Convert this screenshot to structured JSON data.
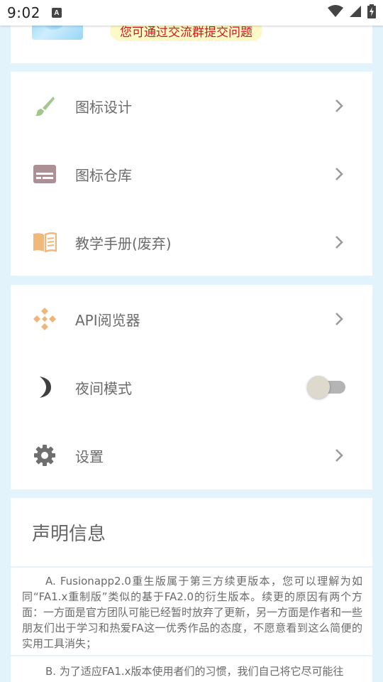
{
  "status_bar": {
    "time": "9:02",
    "notif_letter": "A"
  },
  "top_card": {
    "notice": "您可通过交流群提交问题"
  },
  "menu_group_1": {
    "items": [
      {
        "label": "图标设计",
        "icon": "paintbrush-icon",
        "icon_color": "#a5c68f"
      },
      {
        "label": "图标仓库",
        "icon": "storage-box-icon",
        "icon_color": "#ad8f96"
      },
      {
        "label": "教学手册(废弃)",
        "icon": "open-book-icon",
        "icon_color": "#f0b879"
      }
    ]
  },
  "menu_group_2": {
    "items": [
      {
        "label": "API阅览器",
        "icon": "api-diamond-icon",
        "icon_color": "#f0b37a"
      },
      {
        "label": "夜间模式",
        "icon": "moon-icon",
        "icon_color": "#444444",
        "toggle_on": false
      },
      {
        "label": "设置",
        "icon": "gear-icon",
        "icon_color": "#6f6f6f"
      }
    ]
  },
  "statement": {
    "title": "声明信息",
    "paragraphs": [
      "A. Fusionapp2.0重生版属于第三方续更版本，您可以理解为如同“FA1.x重制版”类似的基于FA2.0的衍生版本。续更的原因有两个方面：一方面是官方团队可能已经暂时放弃了更新，另一方面是作者和一些朋友们出于学习和热爱FA这一优秀作品的态度，不愿意看到这么简便的实用工具消失；",
      "B. 为了适应FA1.x版本使用者们的习惯，我们自己将它尽可能往"
    ]
  },
  "colors": {
    "background": "#e3f3fb",
    "card": "#ffffff",
    "notice_text": "#d01818",
    "notice_bg": "#fdf9c8"
  }
}
